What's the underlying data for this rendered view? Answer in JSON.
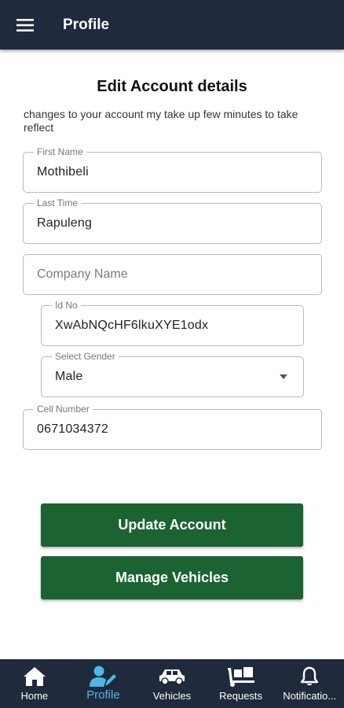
{
  "appbar": {
    "title": "Profile",
    "menu_icon": "hamburger-menu-icon"
  },
  "form": {
    "heading": "Edit Account details",
    "note": "changes to your account my take up few minutes to take reflect",
    "first_name": {
      "label": "First Name",
      "value": "Mothibeli"
    },
    "last_name": {
      "label": "Last Time",
      "value": "Rapuleng"
    },
    "company_name": {
      "placeholder": "Company Name"
    },
    "id_no": {
      "label": "Id No",
      "value": "XwAbNQcHF6lkuXYE1odx"
    },
    "gender": {
      "label": "Select Gender",
      "value": "Male"
    },
    "cell_number": {
      "label": "Cell Number",
      "value": "0671034372"
    }
  },
  "buttons": {
    "update": "Update Account",
    "manage": "Manage Vehicles"
  },
  "nav": {
    "items": [
      {
        "label": "Home",
        "icon": "home-icon"
      },
      {
        "label": "Profile",
        "icon": "user-edit-icon",
        "active": true
      },
      {
        "label": "Vehicles",
        "icon": "vehicles-icon"
      },
      {
        "label": "Requests",
        "icon": "dolly-icon"
      },
      {
        "label": "Notificatio...",
        "icon": "bell-icon"
      }
    ]
  },
  "colors": {
    "bar": "#1f2a3c",
    "button": "#1b6431",
    "active_nav": "#4fb6e6"
  }
}
